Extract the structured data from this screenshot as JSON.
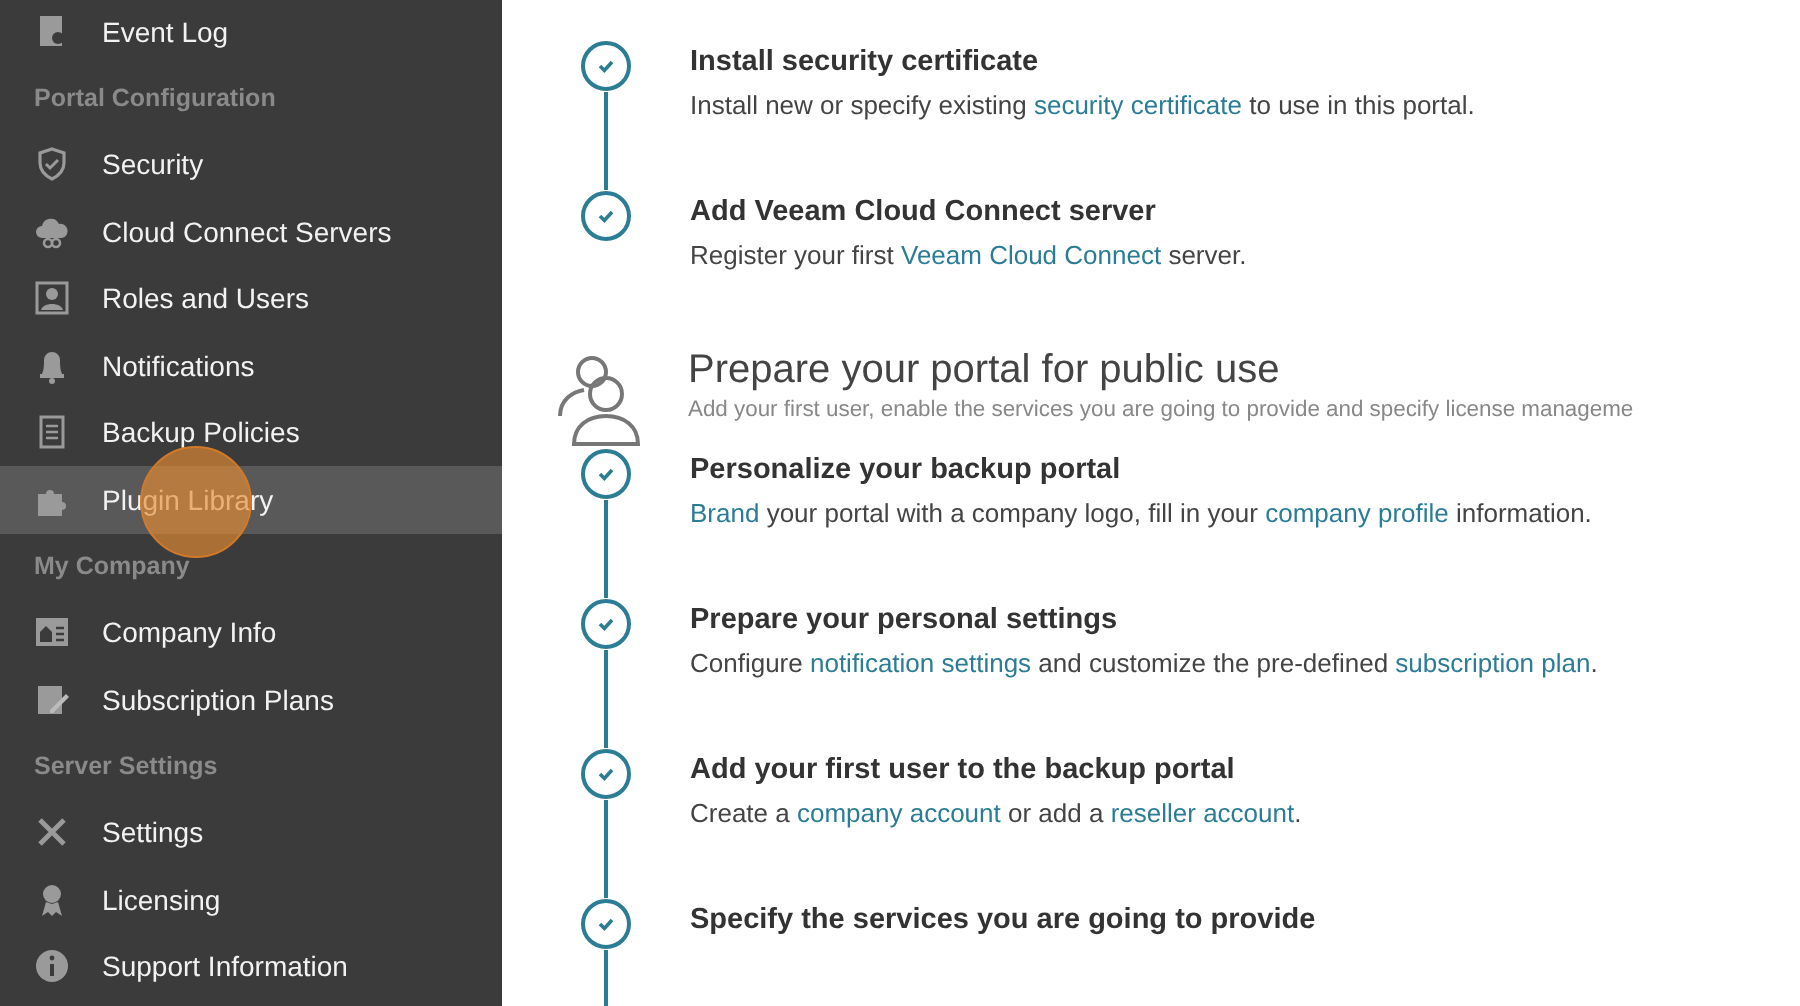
{
  "sidebar": {
    "items": [
      {
        "kind": "item",
        "label": "Event Log",
        "selected": false
      },
      {
        "kind": "section",
        "label": "Portal Configuration"
      },
      {
        "kind": "item",
        "label": "Security",
        "selected": false
      },
      {
        "kind": "item",
        "label": "Cloud Connect Servers",
        "selected": false
      },
      {
        "kind": "item",
        "label": "Roles and Users",
        "selected": false
      },
      {
        "kind": "item",
        "label": "Notifications",
        "selected": false
      },
      {
        "kind": "item",
        "label": "Backup Policies",
        "selected": false
      },
      {
        "kind": "item",
        "label": "Plugin Library",
        "selected": true
      },
      {
        "kind": "section",
        "label": "My Company"
      },
      {
        "kind": "item",
        "label": "Company Info",
        "selected": false
      },
      {
        "kind": "item",
        "label": "Subscription Plans",
        "selected": false
      },
      {
        "kind": "section",
        "label": "Server Settings"
      },
      {
        "kind": "item",
        "label": "Settings",
        "selected": false
      },
      {
        "kind": "item",
        "label": "Licensing",
        "selected": false
      },
      {
        "kind": "item",
        "label": "Support Information",
        "selected": false
      }
    ]
  },
  "groups": [
    {
      "steps": [
        {
          "title": "Install security certificate",
          "completed": true,
          "connected": true,
          "description": [
            {
              "text": "Install new or specify existing "
            },
            {
              "text": "security certificate",
              "link": true
            },
            {
              "text": " to use in this portal."
            }
          ]
        },
        {
          "title": "Add Veeam Cloud Connect server",
          "completed": true,
          "connected": false,
          "description": [
            {
              "text": "Register your first "
            },
            {
              "text": "Veeam Cloud Connect",
              "link": true
            },
            {
              "text": " server."
            }
          ]
        }
      ]
    },
    {
      "title": "Prepare your portal for public use",
      "subtitle": "Add your first user, enable the services you are going to provide and specify license manageme",
      "steps": [
        {
          "title": "Personalize your backup portal",
          "completed": true,
          "connected": true,
          "description": [
            {
              "text": "Brand",
              "link": true
            },
            {
              "text": " your portal with a company logo, fill in your "
            },
            {
              "text": "company profile",
              "link": true
            },
            {
              "text": " information."
            }
          ]
        },
        {
          "title": "Prepare your personal settings",
          "completed": true,
          "connected": true,
          "description": [
            {
              "text": "Configure "
            },
            {
              "text": "notification settings",
              "link": true
            },
            {
              "text": " and customize the pre-defined "
            },
            {
              "text": "subscription plan",
              "link": true
            },
            {
              "text": "."
            }
          ]
        },
        {
          "title": "Add your first user to the backup portal",
          "completed": true,
          "connected": true,
          "description": [
            {
              "text": "Create a "
            },
            {
              "text": "company account",
              "link": true
            },
            {
              "text": " or add a "
            },
            {
              "text": "reseller account",
              "link": true
            },
            {
              "text": "."
            }
          ]
        },
        {
          "title": "Specify the services you are going to provide",
          "completed": true,
          "connected": true
        }
      ]
    }
  ]
}
